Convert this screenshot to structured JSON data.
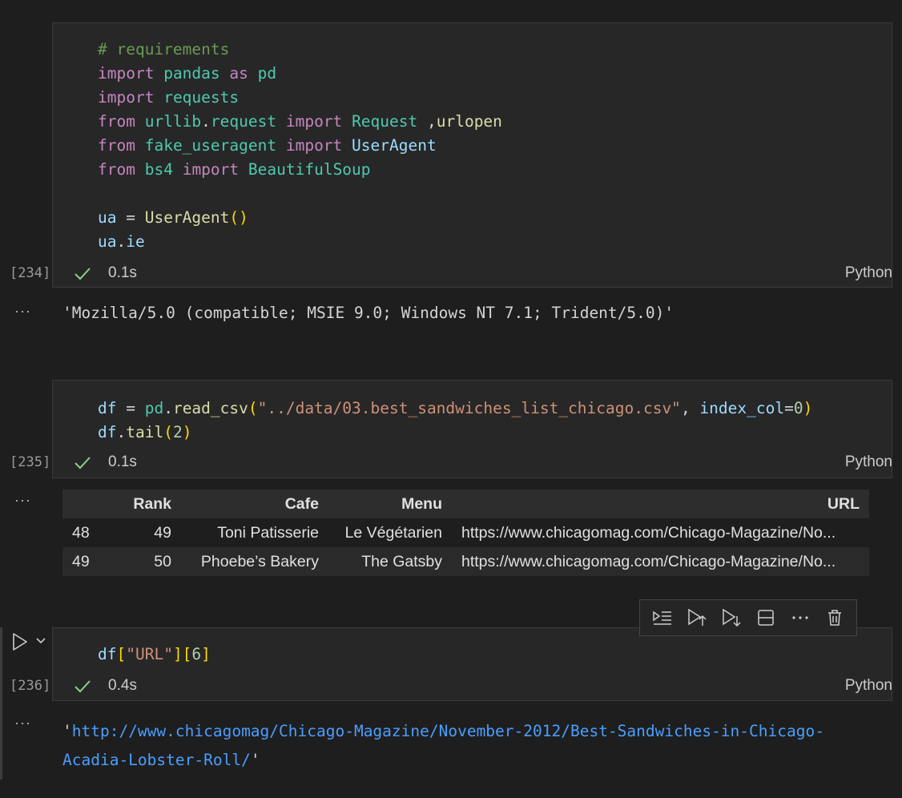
{
  "cells": [
    {
      "exec_count": "[234]",
      "duration": "0.1s",
      "language": "Python",
      "output_text": "'Mozilla/5.0 (compatible; MSIE 9.0; Windows NT 7.1; Trident/5.0)'"
    },
    {
      "exec_count": "[235]",
      "duration": "0.1s",
      "language": "Python",
      "table": {
        "headers": [
          "",
          "Rank",
          "Cafe",
          "Menu",
          "URL"
        ],
        "rows": [
          [
            "48",
            "49",
            "Toni Patisserie",
            "Le Végétarien",
            "https://www.chicagomag.com/Chicago-Magazine/No..."
          ],
          [
            "49",
            "50",
            "Phoebe’s Bakery",
            "The Gatsby",
            "https://www.chicagomag.com/Chicago-Magazine/No..."
          ]
        ]
      }
    },
    {
      "exec_count": "[236]",
      "duration": "0.4s",
      "language": "Python",
      "output_quote_open": "'",
      "output_link_line1": "http://www.chicagomag/Chicago-Magazine/November-2012/Best-Sandwiches-in-Chicago-",
      "output_link_line2": "Acadia-Lobster-Roll/",
      "output_quote_close": "'"
    }
  ],
  "ellipsis": "···",
  "icons": [
    "run-icon",
    "chevron-down-icon",
    "execute-above-icon",
    "run-above-icon",
    "run-below-icon",
    "split-cell-icon",
    "more-icon",
    "delete-icon",
    "checkmark-icon"
  ],
  "colors": {
    "background": "#1e1e1e",
    "cell_bg": "#272727",
    "success": "#89d185",
    "link": "#4a9eff"
  }
}
